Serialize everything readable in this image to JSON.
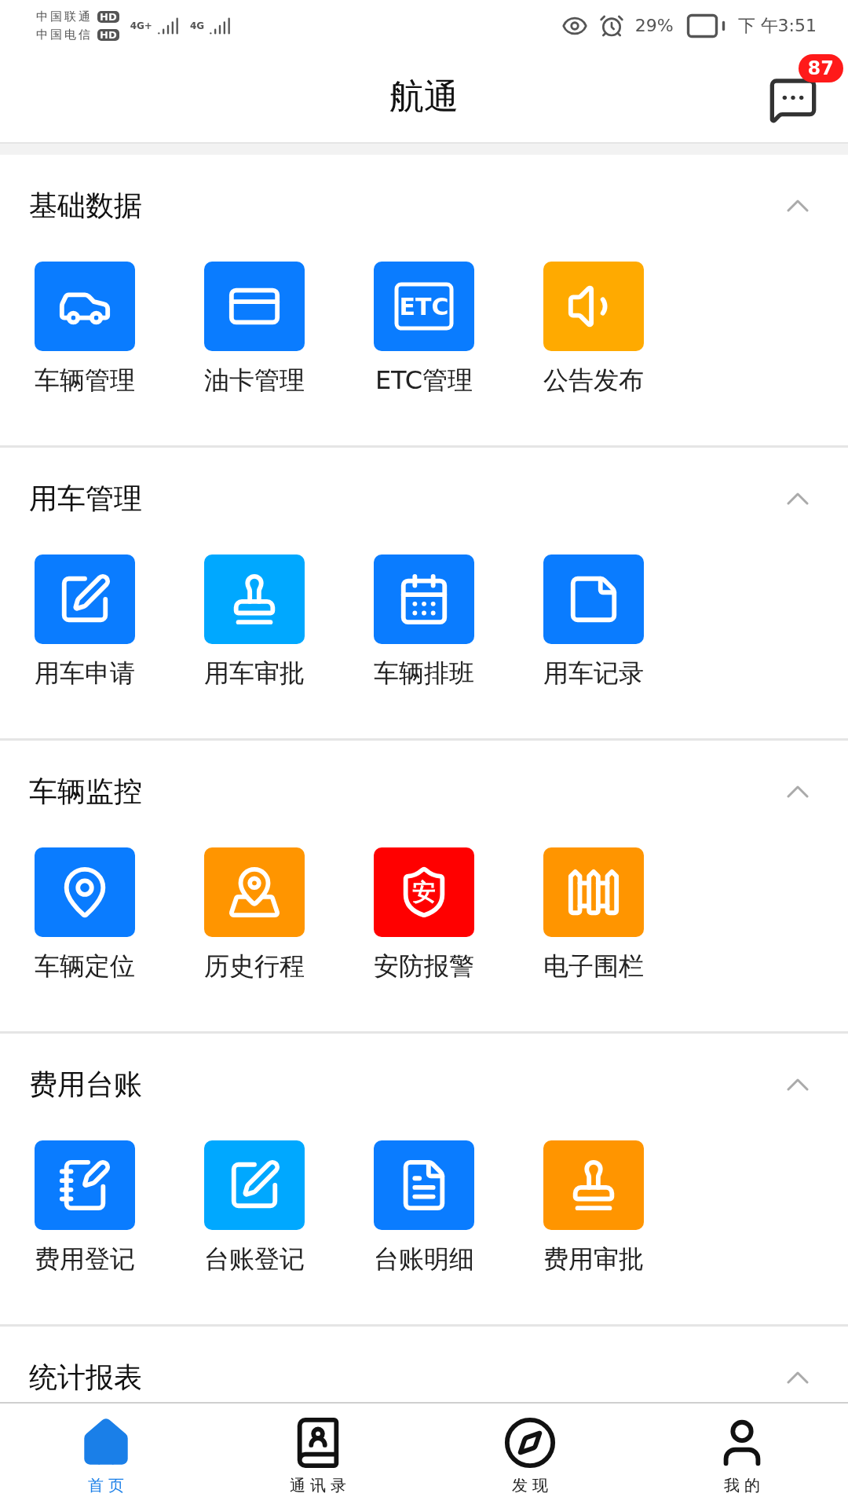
{
  "status_bar": {
    "carriers": [
      {
        "name": "中国联通",
        "hd": "HD"
      },
      {
        "name": "中国电信",
        "hd": "HD"
      }
    ],
    "networks": [
      "4G+",
      "4G"
    ],
    "battery_percent": "29%",
    "time": "下 午3:51"
  },
  "header": {
    "title": "航通",
    "badge": "87"
  },
  "sections": [
    {
      "title": "基础数据",
      "expanded": true,
      "items": [
        {
          "label": "车辆管理",
          "color": "#0a7cff"
        },
        {
          "label": "油卡管理",
          "color": "#0a7cff"
        },
        {
          "label": "ETC管理",
          "color": "#0a7cff",
          "icon_text": "ETC"
        },
        {
          "label": "公告发布",
          "color": "#ffaa00"
        }
      ]
    },
    {
      "title": "用车管理",
      "expanded": true,
      "items": [
        {
          "label": "用车申请",
          "color": "#0a7cff"
        },
        {
          "label": "用车审批",
          "color": "#00a8ff"
        },
        {
          "label": "车辆排班",
          "color": "#0a7cff"
        },
        {
          "label": "用车记录",
          "color": "#0a7cff"
        }
      ]
    },
    {
      "title": "车辆监控",
      "expanded": true,
      "items": [
        {
          "label": "车辆定位",
          "color": "#0a7cff"
        },
        {
          "label": "历史行程",
          "color": "#ff9500"
        },
        {
          "label": "安防报警",
          "color": "#ff0000",
          "icon_text": "安"
        },
        {
          "label": "电子围栏",
          "color": "#ff9500"
        }
      ]
    },
    {
      "title": "费用台账",
      "expanded": true,
      "items": [
        {
          "label": "费用登记",
          "color": "#0a7cff"
        },
        {
          "label": "台账登记",
          "color": "#00a8ff"
        },
        {
          "label": "台账明细",
          "color": "#0a7cff"
        },
        {
          "label": "费用审批",
          "color": "#ff9500"
        }
      ]
    },
    {
      "title": "统计报表",
      "expanded": true
    }
  ],
  "tabs": [
    {
      "label": "首 页",
      "selected": true
    },
    {
      "label": "通 讯 录",
      "selected": false
    },
    {
      "label": "发 现",
      "selected": false
    },
    {
      "label": "我 的",
      "selected": false
    }
  ]
}
